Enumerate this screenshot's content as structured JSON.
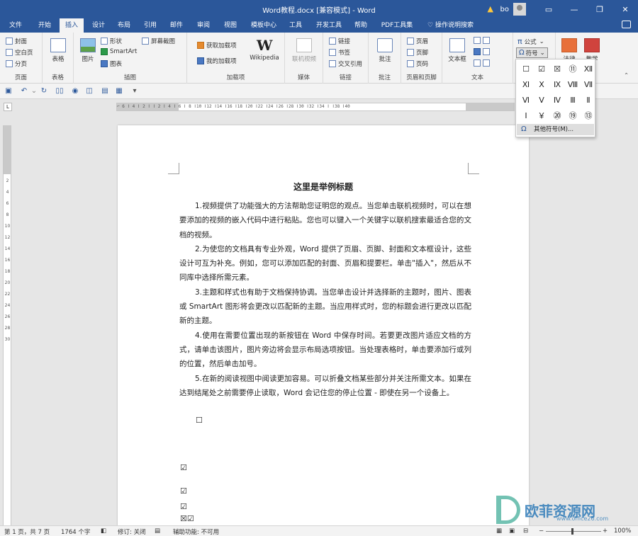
{
  "titlebar": {
    "title": "Word教程.docx [兼容模式]  -  Word",
    "user": "bo",
    "minimize": "—",
    "restore": "❐",
    "close": "✕"
  },
  "tabs": [
    "文件",
    "开始",
    "插入",
    "设计",
    "布局",
    "引用",
    "邮件",
    "审阅",
    "视图",
    "模板中心",
    "工具",
    "开发工具",
    "帮助",
    "PDF工具集"
  ],
  "active_tab": "插入",
  "tell_me": "操作说明搜索",
  "ribbon": {
    "pages": {
      "cover": "封面",
      "blank": "空白页",
      "break": "分页",
      "label": "页面"
    },
    "tables": {
      "table": "表格",
      "label": "表格"
    },
    "illustrations": {
      "picture": "图片",
      "shapes": "形状",
      "smartart": "SmartArt",
      "chart": "图表",
      "screenshot": "屏幕截图",
      "label": "插图"
    },
    "addins": {
      "get": "获取加载项",
      "mine": "我的加载项",
      "wikipedia": "Wikipedia",
      "label": "加载项"
    },
    "media": {
      "video": "联机视频",
      "label": "媒体"
    },
    "links": {
      "link": "链接",
      "bookmark": "书签",
      "crossref": "交叉引用",
      "label": "链接"
    },
    "comments": {
      "comment": "批注",
      "label": "批注"
    },
    "header_footer": {
      "header": "页眉",
      "footer": "页脚",
      "page_number": "页码",
      "label": "页眉和页脚"
    },
    "text": {
      "textbox": "文本框",
      "label": "文本"
    },
    "symbols": {
      "equation": "公式",
      "symbol": "符号"
    },
    "extra": {
      "law": "法律",
      "teach": "教学"
    }
  },
  "symbol_dropdown": {
    "symbols": [
      "☐",
      "☑",
      "☒",
      "⑪",
      "Ⅻ",
      "Ⅺ",
      "Ⅹ",
      "Ⅸ",
      "Ⅷ",
      "Ⅶ",
      "Ⅵ",
      "Ⅴ",
      "Ⅳ",
      "Ⅲ",
      "Ⅱ",
      "Ⅰ",
      "￥",
      "⑳",
      "⑲",
      "⑬"
    ],
    "more": "其他符号(M)..."
  },
  "ruler": {
    "h_ticks": "⌐ 6 ǀ 4 ǀ 2 ǀ    ǀ 2 ǀ 4 ǀ 6 ǀ 8 ǀ10 ǀ12 ǀ14 ǀ16 ǀ18 ǀ20 ǀ22 ǀ24 ǀ26 ǀ28 ǀ30 ǀ32 ǀ34 ǀ  ǀ38 ǀ40",
    "v_ticks": [
      "2",
      "4",
      "6",
      "8",
      "10",
      "12",
      "14",
      "16",
      "18",
      "20",
      "22",
      "24",
      "26",
      "28",
      "30"
    ],
    "corner": "L"
  },
  "document": {
    "title": "这里是举例标题",
    "paragraphs": [
      "1.视频提供了功能强大的方法帮助您证明您的观点。当您单击联机视频时，可以在想要添加的视频的嵌入代码中进行粘贴。您也可以键入一个关键字以联机搜索最适合您的文档的视频。",
      "2.为使您的文档具有专业外观，Word 提供了页眉、页脚、封面和文本框设计，这些设计可互为补充。例如，您可以添加匹配的封面、页眉和提要栏。单击\"插入\"，然后从不同库中选择所需元素。",
      "3.主题和样式也有助于文档保持协调。当您单击设计并选择新的主题时，图片、图表或 SmartArt 图形将会更改以匹配新的主题。当应用样式时，您的标题会进行更改以匹配新的主题。",
      "4.使用在需要位置出现的新按钮在 Word 中保存时间。若要更改图片适应文档的方式，请单击该图片，图片旁边将会显示布局选项按钮。当处理表格时，单击要添加行或列的位置，然后单击加号。",
      "5.在新的阅读视图中阅读更加容易。可以折叠文档某些部分并关注所需文本。如果在达到结尾处之前需要停止读取，Word 会记住您的停止位置 - 即使在另一个设备上。"
    ],
    "symbols": [
      "☐",
      "☑",
      "☑",
      "☑",
      "☒☑"
    ]
  },
  "statusbar": {
    "page": "第 1 页，共 7 页",
    "words": "1764 个字",
    "track": "修订: 关闭",
    "accessibility": "辅助功能: 不可用",
    "zoom": "100%"
  },
  "watermark": {
    "text": "欧菲资源网",
    "url": "www.office26.com"
  }
}
